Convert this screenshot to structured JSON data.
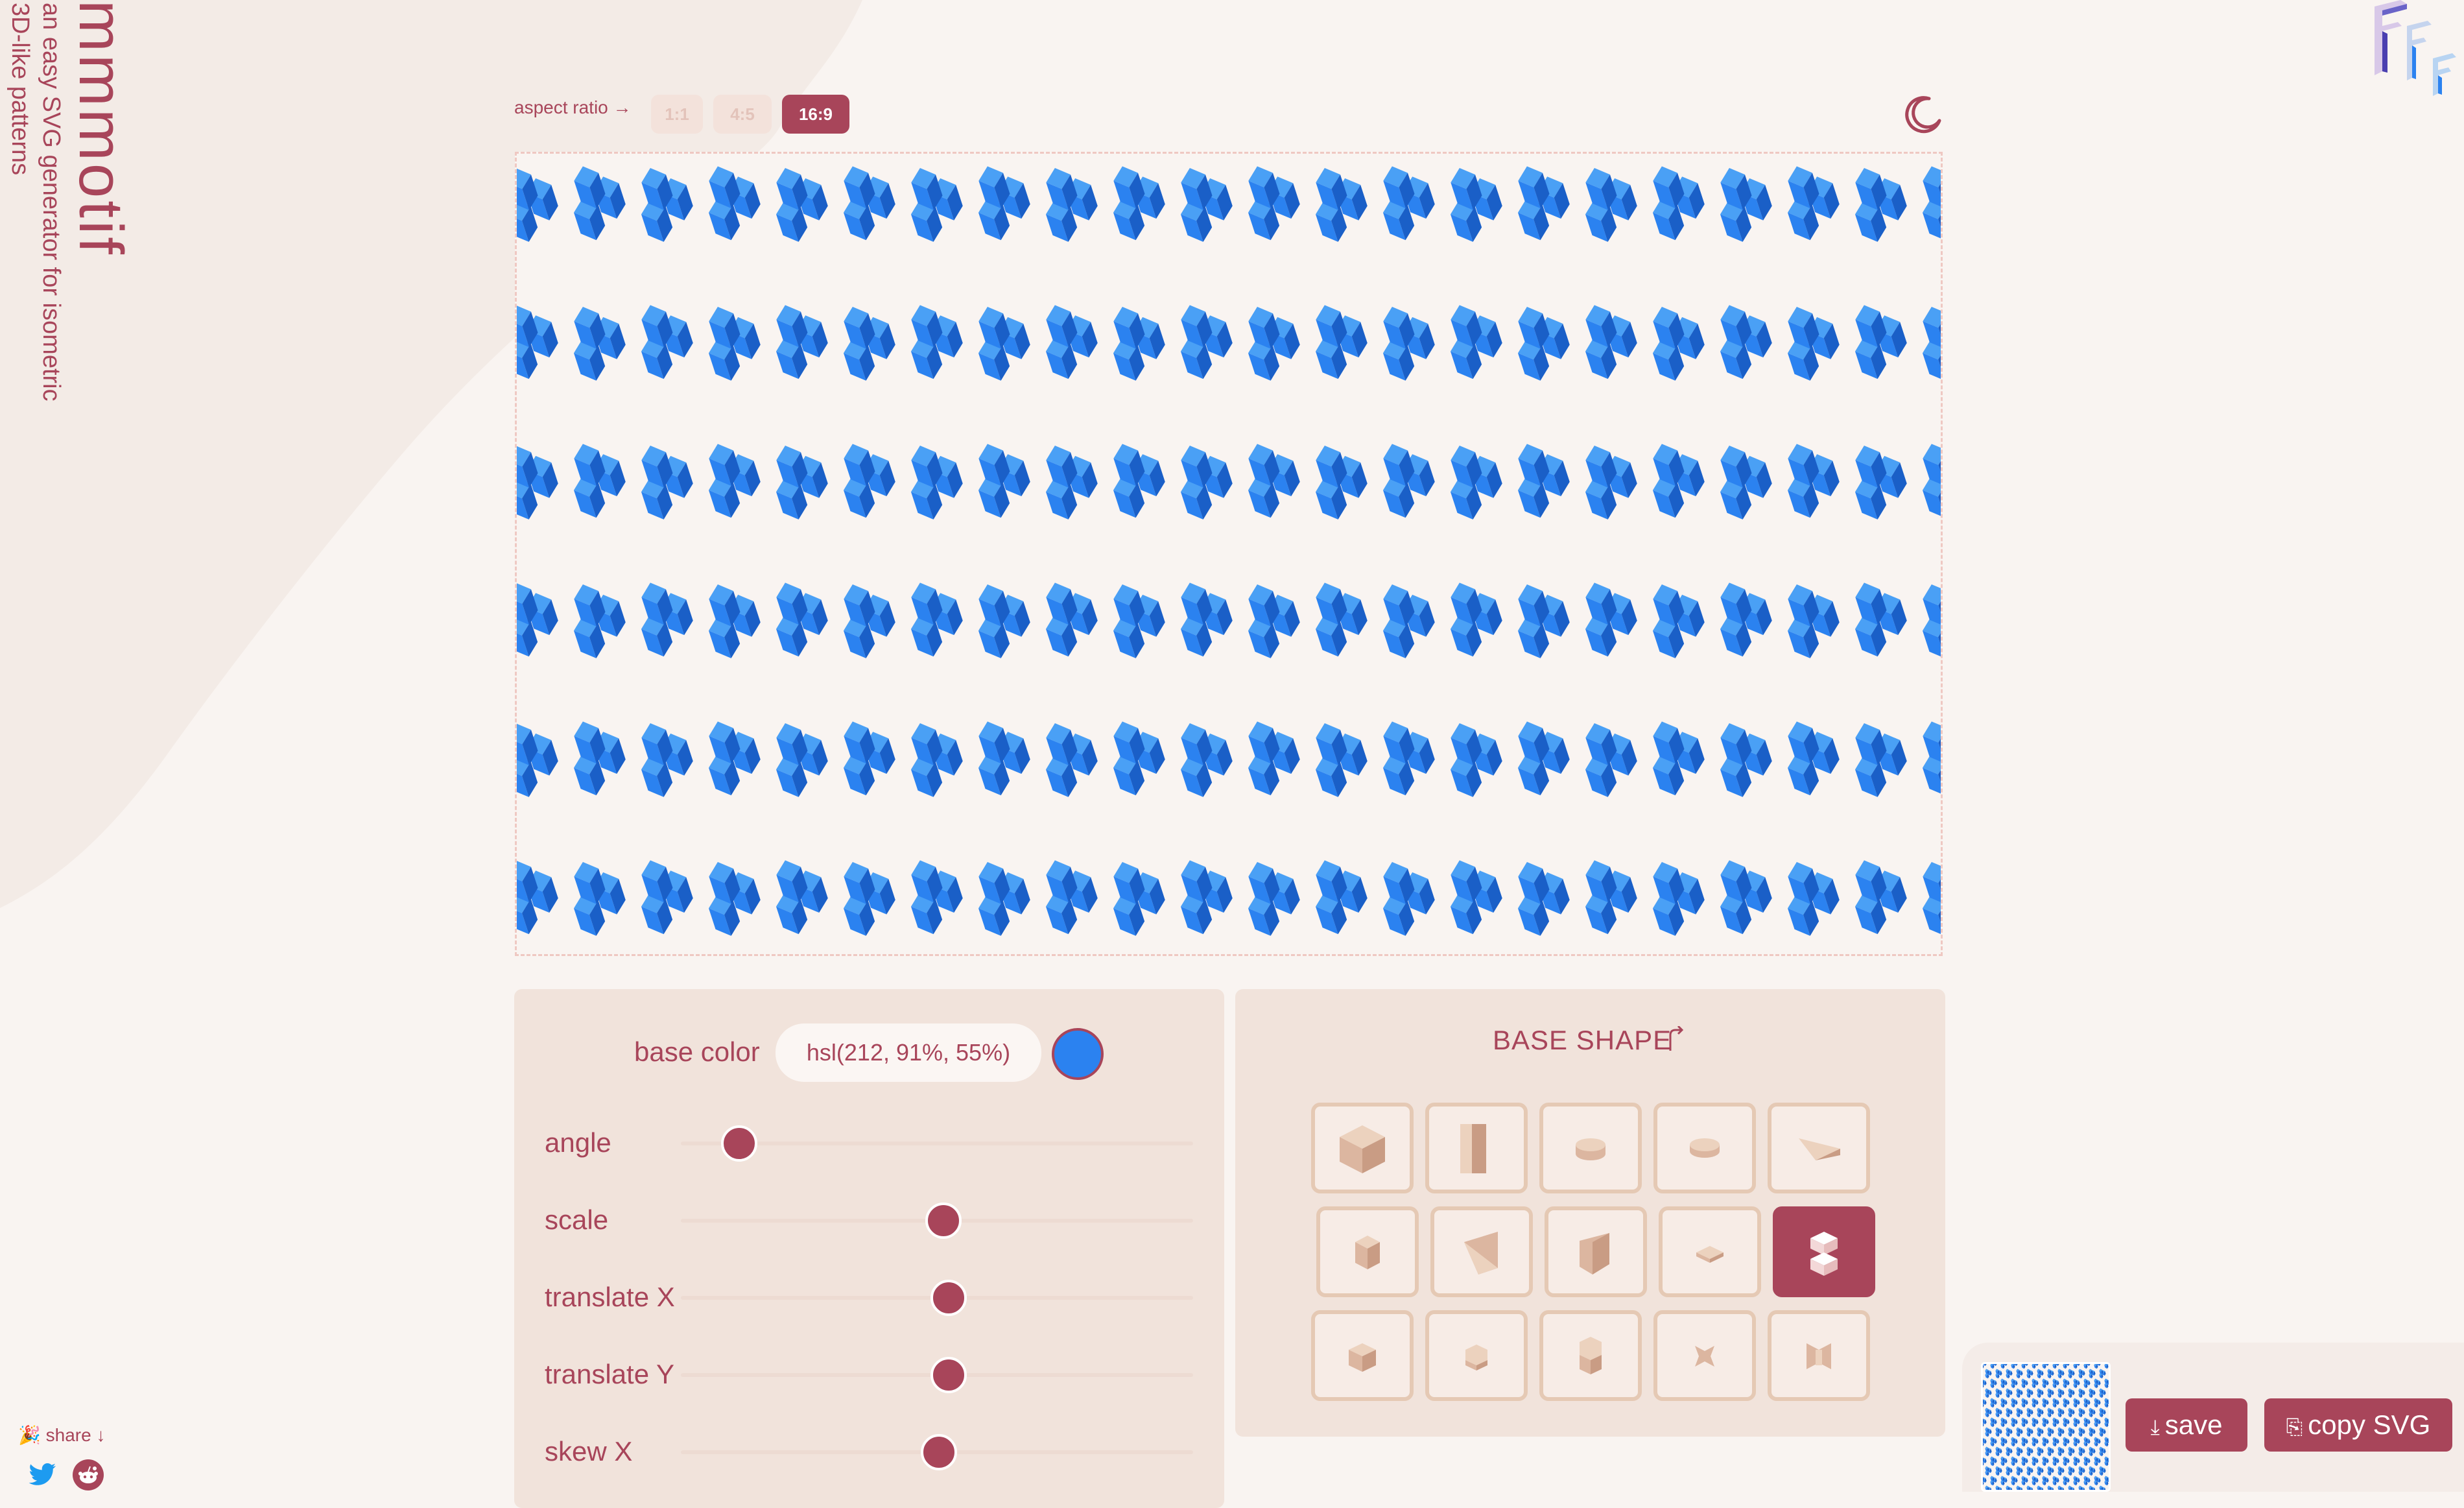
{
  "app": {
    "title": "mmmotif",
    "subtitle_line1": "an easy SVG generator for isometric",
    "subtitle_line2": "3D-like patterns",
    "share_label": "🎉 share ↓",
    "share_links": [
      "twitter-icon",
      "reddit-icon"
    ],
    "logo_icon": "fffuel-logo"
  },
  "toolbar": {
    "aspect_ratio_label": "aspect ratio →",
    "aspect_ratios": [
      "1:1",
      "4:5",
      "16:9"
    ],
    "selected_aspect_ratio": "16:9",
    "theme_toggle_icon": "moon-icon"
  },
  "controls": {
    "base_color_label": "base color",
    "base_color_value": "hsl(212, 91%, 55%)",
    "base_color_hex": "#2b82f0",
    "sliders": [
      {
        "label": "angle",
        "level": 0.12
      },
      {
        "label": "scale",
        "level": 0.54
      },
      {
        "label": "translate X",
        "level": 0.55
      },
      {
        "label": "translate Y",
        "level": 0.55
      },
      {
        "label": "skew X",
        "level": 0.53
      }
    ]
  },
  "shapes": {
    "title": "BASE SHAPE",
    "title_icon": "corner-up-right-icon",
    "selected_index": 9,
    "items": [
      "cube",
      "tall-box",
      "short-cylinder",
      "flat-cylinder",
      "wedge",
      "small-box",
      "tall-wedge",
      "slanted-prism",
      "tile",
      "stacked-cubes",
      "small-cube",
      "hexagon-prism",
      "hexagon-column",
      "cross-shape",
      "bow-shape"
    ]
  },
  "actions": {
    "save_label": "save",
    "copy_label": "copy SVG",
    "save_icon": "download-icon",
    "copy_icon": "clipboard-icon"
  },
  "colors": {
    "accent": "#a8455a",
    "background": "#f9f4f1",
    "panel": "#f1e3db",
    "shape_blue_light": "#4aa0f5",
    "shape_blue_mid": "#2b82f0",
    "shape_blue_dark": "#1a5fc7"
  }
}
